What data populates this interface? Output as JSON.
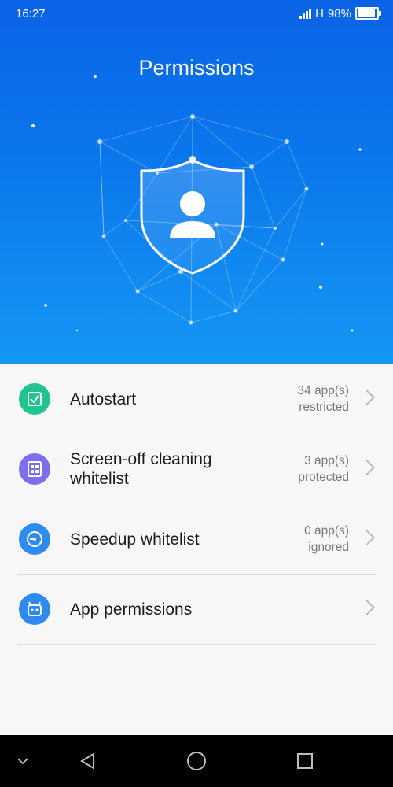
{
  "status_bar": {
    "time": "16:27",
    "network": "H",
    "battery": "98%",
    "battery_level": 0.98
  },
  "header": {
    "title": "Permissions"
  },
  "list": [
    {
      "label": "Autostart",
      "value_line1": "34 app(s)",
      "value_line2": "restricted",
      "icon": "checkbox-icon",
      "color": "#1fc48e"
    },
    {
      "label": "Screen-off cleaning whitelist",
      "value_line1": "3 app(s)",
      "value_line2": "protected",
      "icon": "cleaning-icon",
      "color": "#7b6ef0"
    },
    {
      "label": "Speedup whitelist",
      "value_line1": "0 app(s)",
      "value_line2": "ignored",
      "icon": "speedometer-icon",
      "color": "#2d8bf0"
    },
    {
      "label": "App permissions",
      "value_line1": "",
      "value_line2": "",
      "icon": "android-robot-icon",
      "color": "#2d8bf0"
    }
  ],
  "nav": {
    "icons": [
      "chevron-down-icon",
      "back-triangle-icon",
      "home-circle-icon",
      "recents-square-icon"
    ]
  }
}
